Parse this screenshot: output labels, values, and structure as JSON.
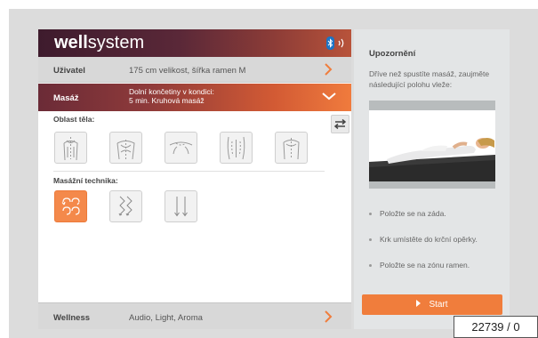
{
  "header": {
    "logo_bold": "well",
    "logo_light": "system"
  },
  "user_row": {
    "label": "Uživatel",
    "value": "175 cm velikost, šířka ramen M"
  },
  "massage_row": {
    "label": "Masáž",
    "value_line1": "Dolní končetiny v kondici:",
    "value_line2": "5 min. Kruhová masáž"
  },
  "body_area": {
    "title": "Oblast těla:",
    "items": [
      "neck-back-icon",
      "upper-back-icon",
      "shoulders-icon",
      "hips-icon",
      "full-back-icon"
    ]
  },
  "technique": {
    "title": "Masážní technika:",
    "items": [
      {
        "icon": "circular-massage-icon",
        "active": true
      },
      {
        "icon": "zigzag-massage-icon",
        "active": false
      },
      {
        "icon": "linear-massage-icon",
        "active": false
      }
    ]
  },
  "wellness_row": {
    "label": "Wellness",
    "value": "Audio, Light, Aroma"
  },
  "sidebar": {
    "title": "Upozornění",
    "text": "Dříve než spustíte masáž, zaujměte následující polohu vleže:",
    "bullets": [
      "Položte se na záda.",
      "Krk umístěte do krční opěrky.",
      "Položte se na zónu ramen."
    ],
    "start_label": "Start"
  },
  "doc_id": "22739 / 0",
  "colors": {
    "accent": "#f07d3c",
    "header_dark": "#3e1b2d",
    "bluetooth": "#1d74c4"
  }
}
